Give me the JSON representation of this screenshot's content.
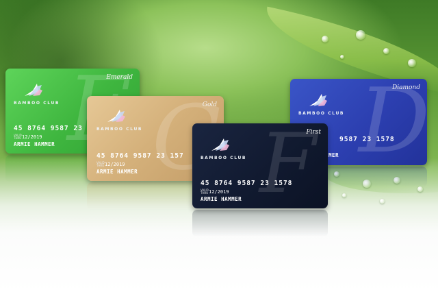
{
  "colors": {
    "emerald": "#3fb63f",
    "gold": "#d4b07a",
    "first": "#111a30",
    "diamond": "#2c3fb0",
    "background_green": "#5d9a36"
  },
  "logo_icon": "bird-wing-icon",
  "cards": {
    "emerald": {
      "tier": "Emerald",
      "brand": "BAMBOO CLUB",
      "number": "45 8764 9587 23",
      "valid_label": "VALID THRU",
      "expiry": "12/2019",
      "holder": "ARMIE HAMMER",
      "monogram": "E"
    },
    "gold": {
      "tier": "Gold",
      "brand": "BAMBOO CLUB",
      "number": "45 8764 9587 23 157",
      "valid_label": "VALID THRU",
      "expiry": "12/2019",
      "holder": "ARMIE HAMMER",
      "monogram": "G"
    },
    "first": {
      "tier": "First",
      "brand": "BAMBOO CLUB",
      "number": "45 8764 9587 23 1578",
      "valid_label": "VALID THRU",
      "expiry": "12/2019",
      "holder": "ARMIE HAMMER",
      "monogram": "F"
    },
    "diamond": {
      "tier": "Diamond",
      "brand": "BAMBOO CLUB",
      "number": "9587 23 1578",
      "holder": "MER",
      "monogram": "D"
    }
  }
}
